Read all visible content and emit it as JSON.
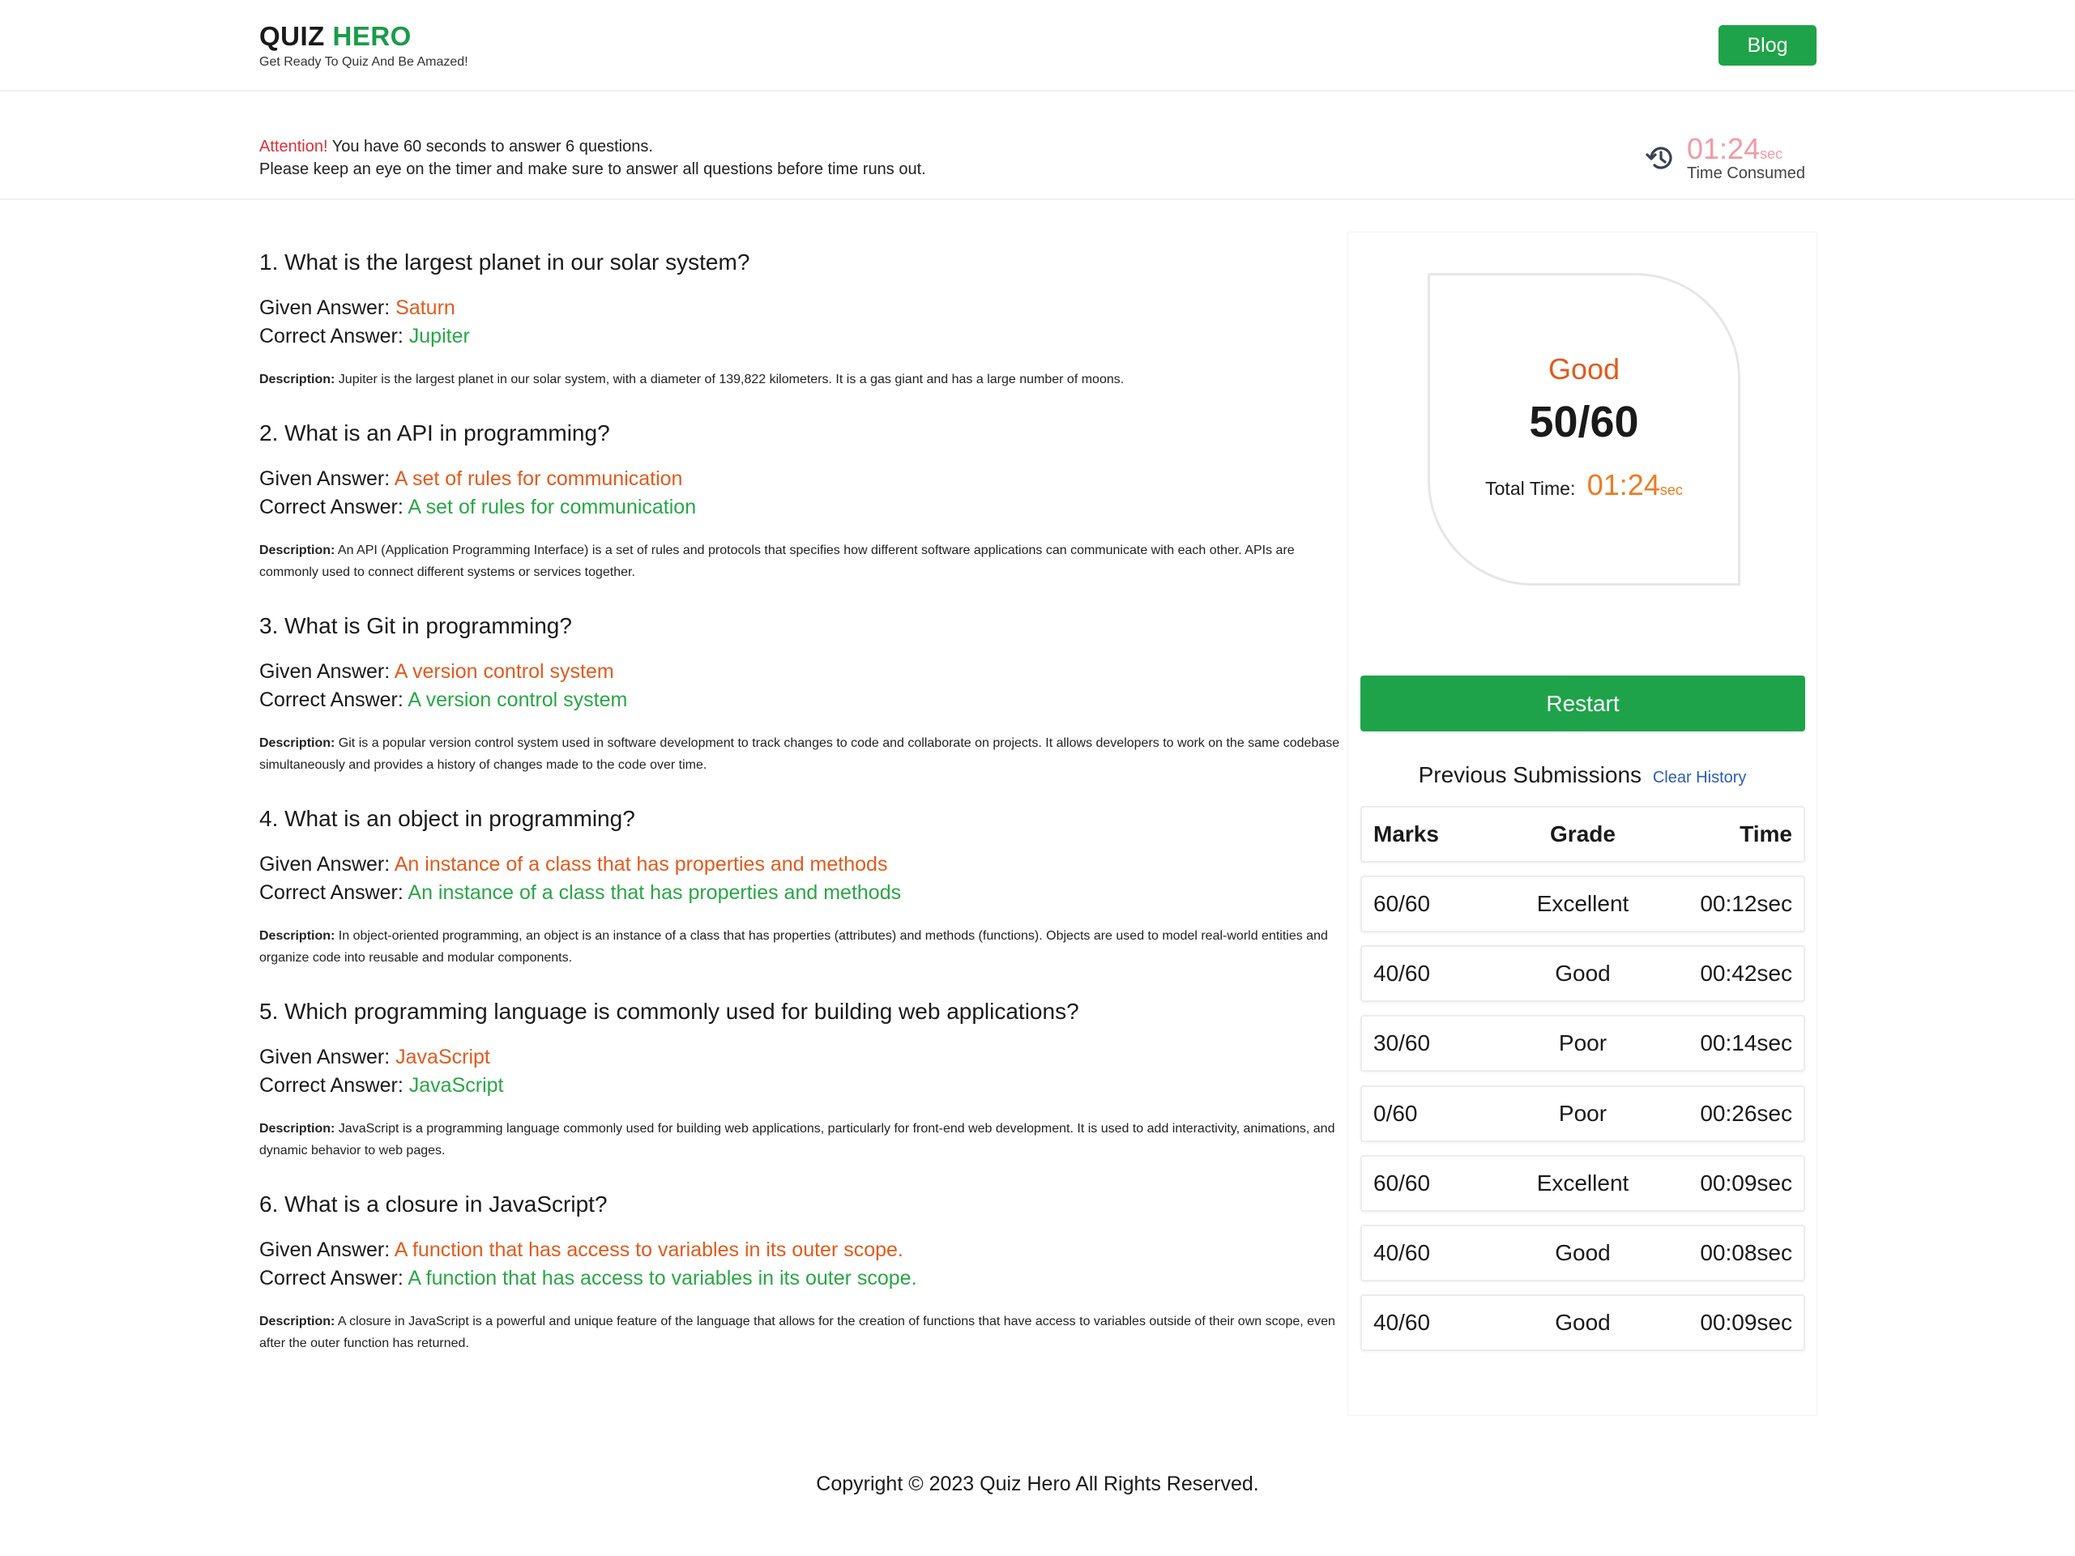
{
  "header": {
    "brand_quiz": "QUIZ",
    "brand_hero": "HERO",
    "tagline": "Get Ready To Quiz And Be Amazed!",
    "blog_label": "Blog"
  },
  "attention": {
    "warn": "Attention!",
    "line1": " You have 60 seconds to answer 6 questions.",
    "line2": "Please keep an eye on the timer and make sure to answer all questions before time runs out.",
    "timer_value": "01:24",
    "timer_unit": "sec",
    "timer_label": "Time Consumed",
    "icon": "history-icon"
  },
  "labels": {
    "given": "Given Answer: ",
    "correct": "Correct Answer: ",
    "description": "Description:"
  },
  "questions": [
    {
      "title": "1. What is the largest planet in our solar system?",
      "given": "Saturn",
      "correct": "Jupiter",
      "description": "Jupiter is the largest planet in our solar system, with a diameter of 139,822 kilometers. It is a gas giant and has a large number of moons."
    },
    {
      "title": "2. What is an API in programming?",
      "given": "A set of rules for communication",
      "correct": "A set of rules for communication",
      "description": "An API (Application Programming Interface) is a set of rules and protocols that specifies how different software applications can communicate with each other. APIs are commonly used to connect different systems or services together."
    },
    {
      "title": "3. What is Git in programming?",
      "given": "A version control system",
      "correct": "A version control system",
      "description": "Git is a popular version control system used in software development to track changes to code and collaborate on projects. It allows developers to work on the same codebase simultaneously and provides a history of changes made to the code over time."
    },
    {
      "title": "4. What is an object in programming?",
      "given": "An instance of a class that has properties and methods",
      "correct": "An instance of a class that has properties and methods",
      "description": "In object-oriented programming, an object is an instance of a class that has properties (attributes) and methods (functions). Objects are used to model real-world entities and organize code into reusable and modular components."
    },
    {
      "title": "5. Which programming language is commonly used for building web applications?",
      "given": "JavaScript",
      "correct": "JavaScript",
      "description": "JavaScript is a programming language commonly used for building web applications, particularly for front-end web development. It is used to add interactivity, animations, and dynamic behavior to web pages."
    },
    {
      "title": "6. What is a closure in JavaScript?",
      "given": "A function that has access to variables in its outer scope.",
      "correct": "A function that has access to variables in its outer scope.",
      "description": "A closure in JavaScript is a powerful and unique feature of the language that allows for the creation of functions that have access to variables outside of their own scope, even after the outer function has returned."
    }
  ],
  "result": {
    "grade": "Good",
    "score": "50/60",
    "total_label": "Total Time:",
    "total_value": "01:24",
    "total_unit": "sec",
    "restart_label": "Restart"
  },
  "history": {
    "title": "Previous Submissions",
    "clear_label": "Clear History",
    "headers": {
      "marks": "Marks",
      "grade": "Grade",
      "time": "Time"
    },
    "rows": [
      {
        "marks": "60/60",
        "grade": "Excellent",
        "time": "00:12sec"
      },
      {
        "marks": "40/60",
        "grade": "Good",
        "time": "00:42sec"
      },
      {
        "marks": "30/60",
        "grade": "Poor",
        "time": "00:14sec"
      },
      {
        "marks": "0/60",
        "grade": "Poor",
        "time": "00:26sec"
      },
      {
        "marks": "60/60",
        "grade": "Excellent",
        "time": "00:09sec"
      },
      {
        "marks": "40/60",
        "grade": "Good",
        "time": "00:08sec"
      },
      {
        "marks": "40/60",
        "grade": "Good",
        "time": "00:09sec"
      }
    ]
  },
  "footer": {
    "copyright": "Copyright © 2023 Quiz Hero All Rights Reserved."
  },
  "colors": {
    "brand_green": "#1a9c4a",
    "button_green": "#1fa34a",
    "given_orange": "#e35a1e",
    "correct_green": "#28a745",
    "warn_red": "#d9303a",
    "timer_pink": "#f39aa4",
    "link_blue": "#2b5cbf"
  }
}
